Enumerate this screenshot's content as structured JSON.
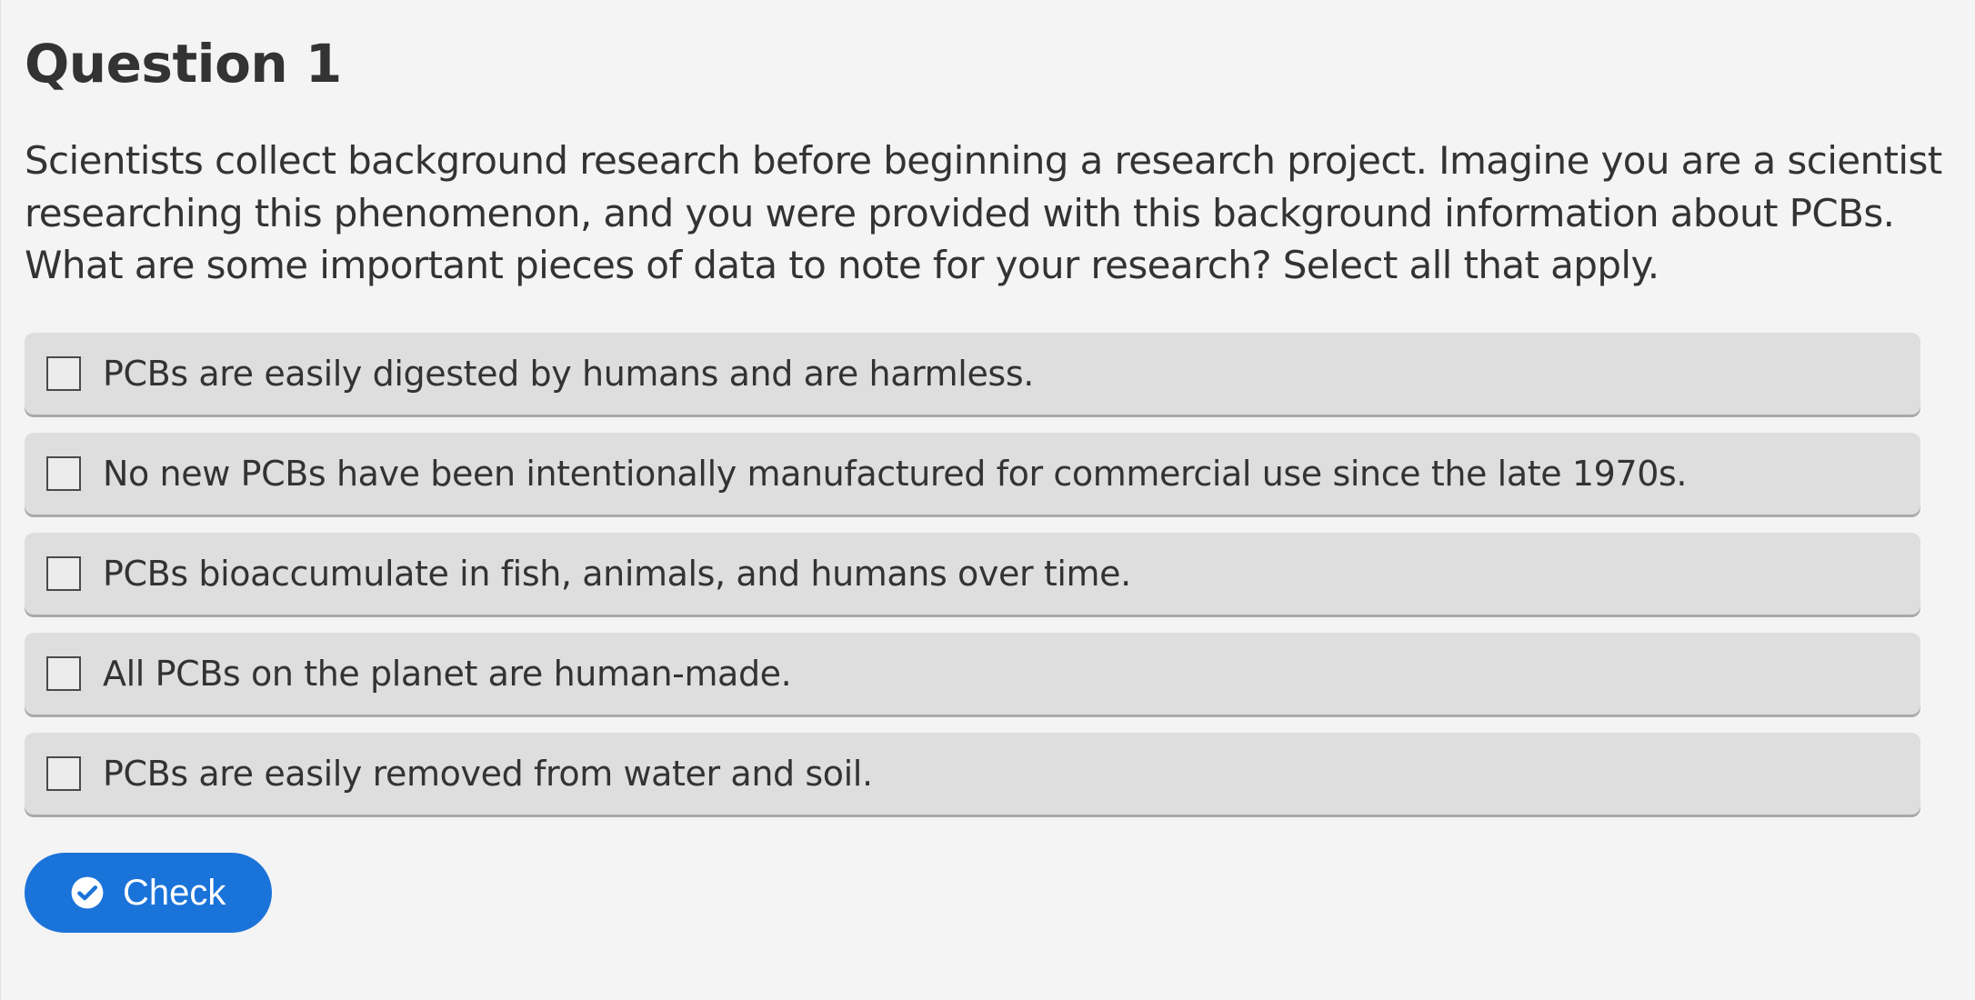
{
  "question": {
    "title": "Question 1",
    "prompt": "Scientists collect background research before beginning a research project. Imagine you are a scientist researching this phenomenon, and you were provided with this background information about PCBs. What are some important pieces of data to note for your research? Select all that apply."
  },
  "options": [
    {
      "label": "PCBs are easily digested by humans and are harmless.",
      "checked": false
    },
    {
      "label": "No new PCBs have been intentionally manufactured for commercial use since the late 1970s.",
      "checked": false
    },
    {
      "label": "PCBs bioaccumulate in fish, animals, and humans over time.",
      "checked": false
    },
    {
      "label": "All PCBs on the planet are human-made.",
      "checked": false
    },
    {
      "label": "PCBs are easily removed from water and soil.",
      "checked": false
    }
  ],
  "check_button": {
    "label": "Check",
    "icon": "check-circle-icon"
  },
  "colors": {
    "background": "#f4f4f4",
    "option_background": "#dedede",
    "text": "#333333",
    "button": "#1a73d9"
  }
}
